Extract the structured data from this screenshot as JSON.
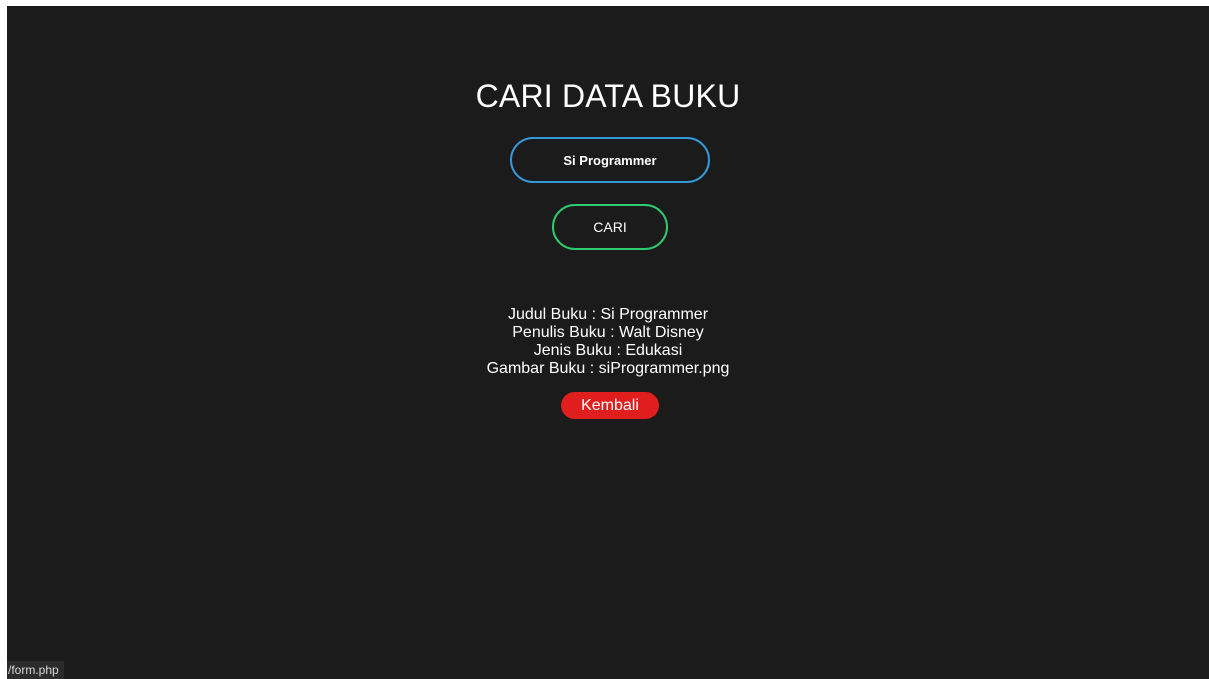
{
  "page": {
    "title": "CARI DATA BUKU"
  },
  "search": {
    "value": "Si Programmer",
    "button_label": "CARI"
  },
  "result": {
    "lines": [
      "Judul Buku : Si Programmer",
      "Penulis Buku : Walt Disney",
      "Jenis Buku : Edukasi",
      "Gambar Buku : siProgrammer.png"
    ],
    "back_label": "Kembali"
  },
  "status_bar": {
    "url": "/form.php"
  },
  "colors": {
    "background": "#1b1b1b",
    "input_border": "#3498db",
    "search_button_border": "#2ecc71",
    "back_button": "#e01e1e",
    "text": "#ffffff"
  }
}
